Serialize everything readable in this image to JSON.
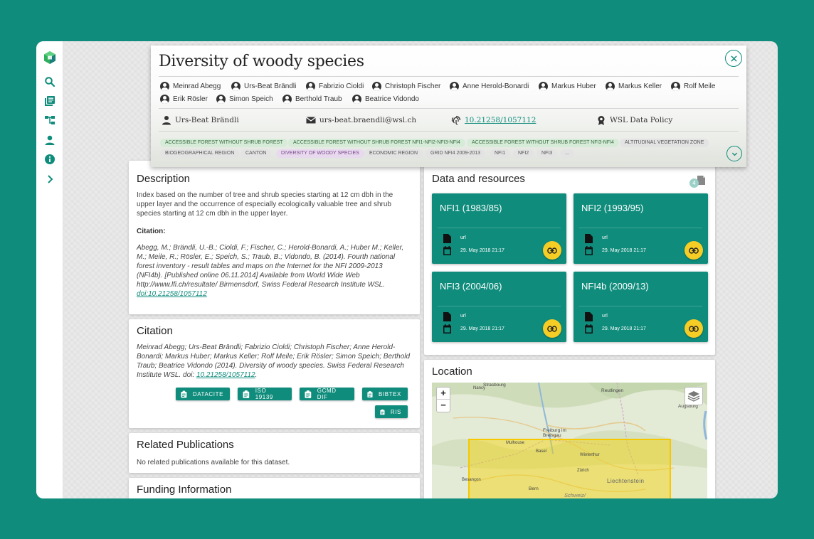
{
  "header": {
    "title": "Diversity of woody species",
    "authors": [
      "Meinrad Abegg",
      "Urs-Beat Brändli",
      "Fabrizio Cioldi",
      "Christoph Fischer",
      "Anne Herold-Bonardi",
      "Markus Huber",
      "Markus Keller",
      "Rolf Meile",
      "Erik Rösler",
      "Simon Speich",
      "Berthold Traub",
      "Beatrice Vidondo"
    ],
    "contact_name": "Urs-Beat Brändli",
    "contact_email": "urs-beat.braendli@wsl.ch",
    "doi": "10.21258/1057112",
    "policy": "WSL Data Policy",
    "tags": [
      {
        "label": "ACCESSIBLE FOREST WITHOUT SHRUB FOREST",
        "style": "green"
      },
      {
        "label": "ACCESSIBLE FOREST WITHOUT SHRUB FOREST NFI1-NFI2-NFI3-NFI4",
        "style": "green"
      },
      {
        "label": "ACCESSIBLE FOREST WITHOUT SHRUB FOREST NFI3-NFI4",
        "style": "green"
      },
      {
        "label": "ALTITUDINAL VEGETATION ZONE",
        "style": "grey"
      },
      {
        "label": "BIOGEOGRAPHICAL REGION",
        "style": "grey"
      },
      {
        "label": "CANTON",
        "style": "grey"
      },
      {
        "label": "DIVERSITY OF WOODY SPECIES",
        "style": "purple"
      },
      {
        "label": "ECONOMIC REGION",
        "style": "grey"
      },
      {
        "label": "GRID NFI4 2009-2013",
        "style": "grey"
      },
      {
        "label": "NFI1",
        "style": "grey"
      },
      {
        "label": "NFI2",
        "style": "grey"
      },
      {
        "label": "NFI3",
        "style": "grey"
      },
      {
        "label": "...",
        "style": "grey"
      }
    ]
  },
  "description": {
    "heading": "Description",
    "text": "Index based on the number of tree and shrub species starting at 12 cm dbh in the upper layer and the occurrence of especially ecologically valuable tree and shrub species starting at 12 cm dbh in the upper layer.",
    "citation_label": "Citation:",
    "citation_text": "Abegg, M.; Brändli, U.-B.; Cioldi, F.; Fischer, C.; Herold-Bonardi, A.; Huber M.; Keller, M.; Meile, R.; Rösler, E.; Speich, S.; Traub, B.; Vidondo, B. (2014). Fourth national forest inventory - result tables and maps on the Internet for the NFI 2009-2013 (NFI4b). [Published online 06.11.2014] Available from World Wide Web http://www.lfi.ch/resultate/ Birmensdorf, Swiss Federal Research Institute WSL.",
    "citation_doi": "doi:10.21258/1057112"
  },
  "citation": {
    "heading": "Citation",
    "text": "Meinrad Abegg; Urs-Beat Brändli; Fabrizio Cioldi; Christoph Fischer; Anne Herold-Bonardi; Markus Huber; Markus Keller; Rolf Meile; Erik Rösler; Simon Speich; Berthold Traub; Beatrice Vidondo (2014). Diversity of woody species. Swiss Federal Research Institute WSL. doi: ",
    "doi": "10.21258/1057112",
    "end": ".",
    "buttons": [
      "DATACITE",
      "ISO 19139",
      "GCMD DIF",
      "BIBTEX",
      "RIS"
    ]
  },
  "related": {
    "heading": "Related Publications",
    "text": "No related publications available for this dataset."
  },
  "funding": {
    "heading": "Funding Information"
  },
  "resources": {
    "heading": "Data and resources",
    "count": "4",
    "items": [
      {
        "title": "NFI1 (1983/85)",
        "type": "url",
        "date": "29. May 2018 21:17"
      },
      {
        "title": "NFI2 (1993/95)",
        "type": "url",
        "date": "29. May 2018 21:17"
      },
      {
        "title": "NFI3 (2004/06)",
        "type": "url",
        "date": "29. May 2018 21:17"
      },
      {
        "title": "NFI4b (2009/13)",
        "type": "url",
        "date": "29. May 2018 21:17"
      }
    ]
  },
  "location": {
    "heading": "Location",
    "zoom_in": "+",
    "zoom_out": "−",
    "places": [
      "Strasbourg",
      "Nancy",
      "Reutlingen",
      "Augsburg",
      "Freiburg im Breisgau",
      "Mulhouse",
      "Basel",
      "Winterthur",
      "Zürich",
      "Besançon",
      "Bern",
      "Liechtenstein",
      "Schweiz/"
    ]
  },
  "colors": {
    "accent": "#0f8c7c",
    "button_yellow": "#f5cd25",
    "bbox": "#f5d200"
  }
}
